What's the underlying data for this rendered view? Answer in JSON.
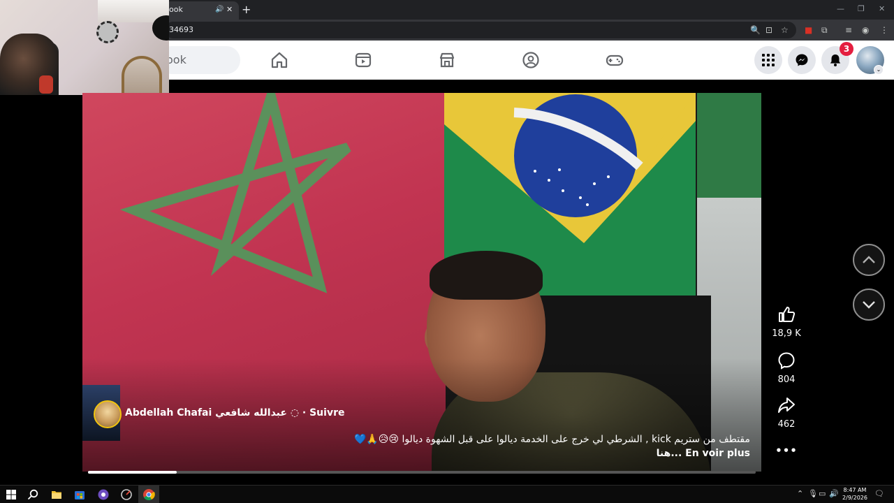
{
  "browser": {
    "tab_title": "ook",
    "url": "34693",
    "new_tab_symbol": "+",
    "close_symbol": "✕"
  },
  "facebook": {
    "search_text": "ook",
    "notifications_count": "3"
  },
  "video": {
    "author": "Abdellah Chafai عبدالله شافعي",
    "follow_label": "· Suivre",
    "caption": "مقتطف من ستريم kick , الشرطي لي خرج على الخدمة ديالوا على قبل الشهوة ديالوا 😢😥🙏💙",
    "caption_more": "هنا... En voir plus",
    "progress": 0.133
  },
  "actions": {
    "likes": "18,9 K",
    "comments": "804",
    "shares": "462",
    "more": "•••"
  },
  "taskbar": {
    "time": "8:47 AM",
    "date": "2/9/2026"
  },
  "icons": [
    "tab-audio-icon",
    "zoom-icon",
    "install-icon",
    "bookmark-star-icon",
    "extensions-icon",
    "media-control-icon",
    "profile-icon",
    "menu-icon",
    "home-icon",
    "watch-icon",
    "marketplace-icon",
    "groups-icon",
    "gaming-icon",
    "apps-grid-icon",
    "messenger-icon",
    "notifications-bell-icon",
    "like-icon",
    "comment-icon",
    "share-icon",
    "more-icon",
    "previous-video-icon",
    "next-video-icon",
    "windows-start-icon",
    "search-taskbar-icon",
    "file-explorer-icon",
    "store-icon",
    "chrome-icon"
  ],
  "colors": {
    "fb_accent": "#0866ff",
    "badge": "#e41e3f"
  }
}
